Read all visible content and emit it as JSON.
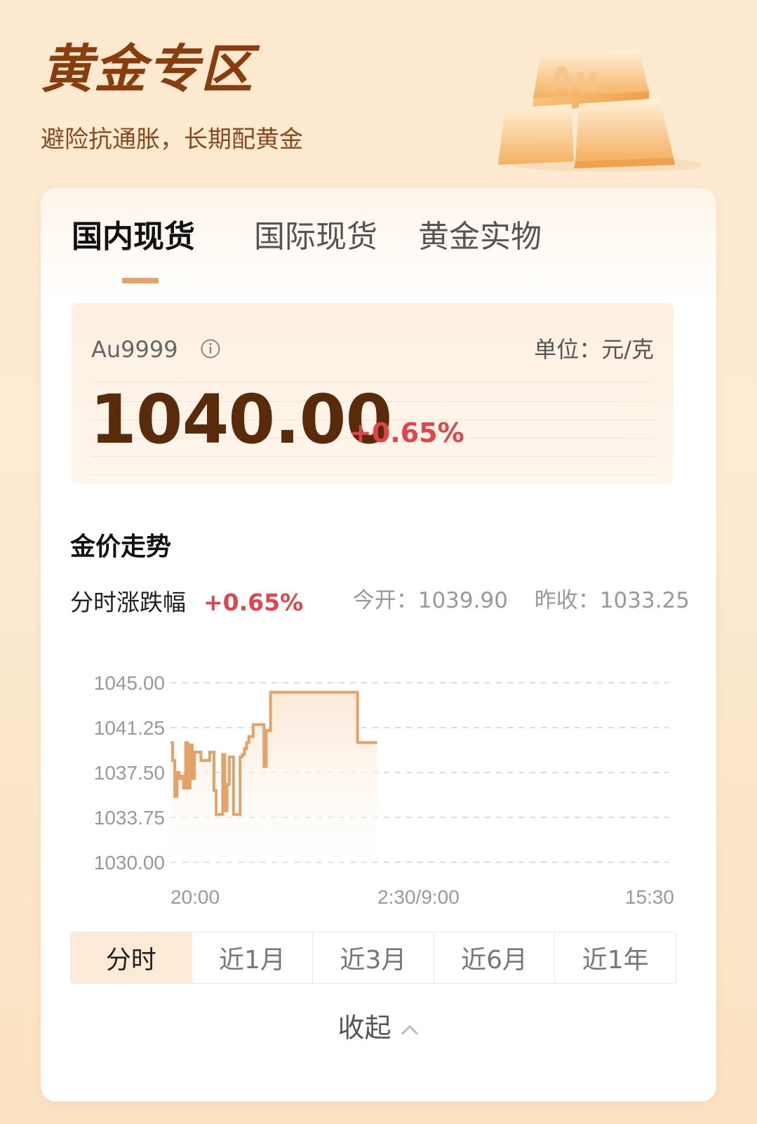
{
  "header": {
    "title": "黄金专区",
    "subtitle": "避险抗通胀，长期配黄金",
    "art_label": "Au"
  },
  "tabs": [
    {
      "label": "国内现货",
      "active": true
    },
    {
      "label": "国际现货",
      "active": false
    },
    {
      "label": "黄金实物",
      "active": false
    }
  ],
  "quote": {
    "symbol": "Au9999",
    "unit": "单位：元/克",
    "price": "1040.00",
    "change": "+0.65%"
  },
  "trend": {
    "section_title": "金价走势",
    "intraday_label": "分时涨跌幅",
    "intraday_change": "+0.65%",
    "open_label": "今开：1039.90",
    "prev_close_label": "昨收：1033.25"
  },
  "chart_data": {
    "type": "line",
    "title": "",
    "xlabel": "",
    "ylabel": "",
    "ylim": [
      1030.0,
      1045.0
    ],
    "yticks": [
      "1045.00",
      "1041.25",
      "1037.50",
      "1033.75",
      "1030.00"
    ],
    "xticks": [
      "20:00",
      "2:30/9:00",
      "15:30"
    ],
    "grid": true,
    "series": [
      {
        "values": [
          1040.0,
          1038.5,
          1035.5,
          1037.5,
          1037.0,
          1037.2,
          1036.2,
          1040.0,
          1036.2,
          1039.8,
          1037.0,
          1039.2,
          1039.2,
          1039.2,
          1038.5,
          1038.5,
          1038.5,
          1038.5,
          1039.2,
          1039.2,
          1036.0,
          1034.0,
          1034.0,
          1034.0,
          1039.0,
          1034.3,
          1036.5,
          1038.8,
          1038.8,
          1034.0,
          1034.0,
          1034.0,
          1038.8,
          1039.0,
          1039.5,
          1040.0,
          1040.5,
          1040.5,
          1041.5,
          1041.5,
          1041.5,
          1041.5,
          1041.5,
          1038.0,
          1041.0,
          1041.0,
          1044.2,
          1044.2,
          1044.2,
          1044.2,
          1044.2,
          1044.2,
          1044.2,
          1044.2,
          1044.2,
          1044.2,
          1044.2,
          1044.2,
          1044.2,
          1044.2,
          1044.2,
          1044.2,
          1044.2,
          1044.2,
          1044.2,
          1044.2,
          1044.2,
          1044.2,
          1044.2,
          1044.2,
          1044.2,
          1044.2,
          1044.2,
          1044.2,
          1044.2,
          1044.2,
          1044.2,
          1044.2,
          1044.2,
          1044.2,
          1044.2,
          1044.2,
          1044.2,
          1044.2,
          1044.2,
          1044.2,
          1040.0,
          1040.0,
          1040.0,
          1040.0,
          1040.0,
          1040.0,
          1040.0,
          1040.0,
          1040.0,
          1040.0
        ]
      }
    ],
    "total_points": 230,
    "colors": {
      "line": "#e3a266",
      "fill_top": "#fbe6d3",
      "fill_bottom": "#ffffff"
    }
  },
  "range_tabs": [
    {
      "label": "分时",
      "active": true
    },
    {
      "label": "近1月",
      "active": false
    },
    {
      "label": "近3月",
      "active": false
    },
    {
      "label": "近6月",
      "active": false
    },
    {
      "label": "近1年",
      "active": false
    }
  ],
  "collapse_label": "收起",
  "icons": {
    "info": "info-icon",
    "collapse": "chevron-up-icon"
  },
  "colors": {
    "accent": "#e3a266",
    "up": "#e0454b",
    "title": "#8a3d0c",
    "price": "#5a2b0a"
  }
}
